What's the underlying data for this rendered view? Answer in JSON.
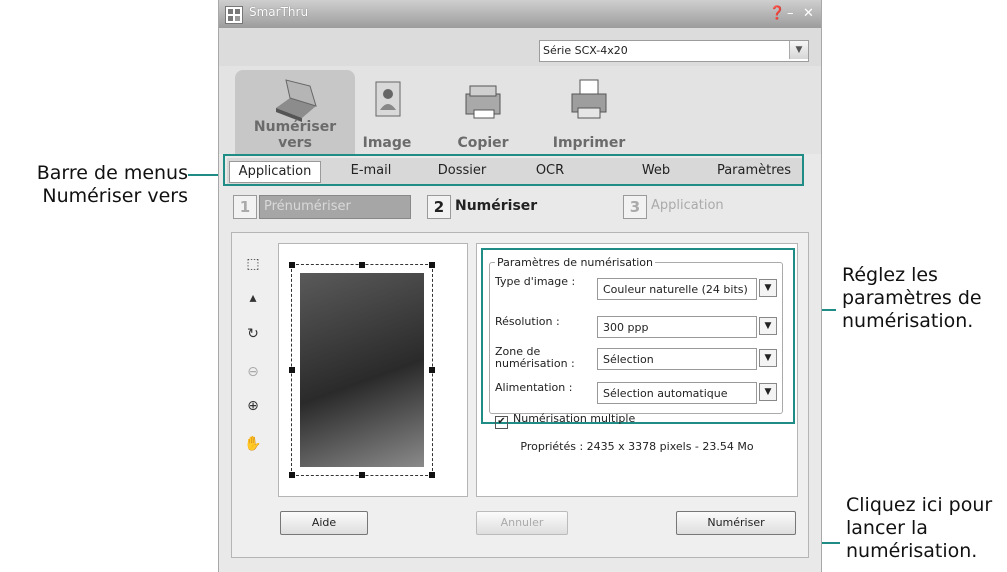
{
  "window": {
    "title": "SmarThru",
    "help_icon": "help-icon",
    "minimize_icon": "minimize-icon",
    "close_icon": "close-icon"
  },
  "model": {
    "selected": "Série SCX-4x20"
  },
  "tools": [
    {
      "label": "Numériser vers",
      "icon": "scanner-icon",
      "active": true
    },
    {
      "label": "Image",
      "icon": "image-icon"
    },
    {
      "label": "Copier",
      "icon": "copier-icon"
    },
    {
      "label": "Imprimer",
      "icon": "printer-icon"
    }
  ],
  "menu": [
    "Application",
    "E-mail",
    "Dossier",
    "OCR",
    "Web",
    "Paramètres"
  ],
  "steps": [
    {
      "num": "1",
      "label": "Prénumériser"
    },
    {
      "num": "2",
      "label": "Numériser"
    },
    {
      "num": "3",
      "label": "Application"
    }
  ],
  "settings": {
    "group_title": "Paramètres de numérisation",
    "image_type_label": "Type d'image :",
    "image_type_value": "Couleur naturelle (24 bits)",
    "resolution_label": "Résolution :",
    "resolution_value": "300 ppp",
    "scan_area_label_1": "Zone de",
    "scan_area_label_2": "numérisation :",
    "scan_area_value": "Sélection",
    "feed_label": "Alimentation :",
    "feed_value": "Sélection automatique",
    "multi_scan_label": "Numérisation multiple",
    "multi_scan_checked": "✔"
  },
  "properties": "Propriétés : 2435 x 3378 pixels - 23.54 Mo",
  "buttons": {
    "help": "Aide",
    "cancel": "Annuler",
    "scan": "Numériser"
  },
  "callouts": {
    "menu_bar_1": "Barre de menus",
    "menu_bar_2": "Numériser vers",
    "settings_1": "Réglez les",
    "settings_2": "paramètres de",
    "settings_3": "numérisation.",
    "scan_1": "Cliquez ici pour",
    "scan_2": "lancer la",
    "scan_3": "numérisation."
  },
  "colors": {
    "callout_line": "#1f8c86"
  }
}
